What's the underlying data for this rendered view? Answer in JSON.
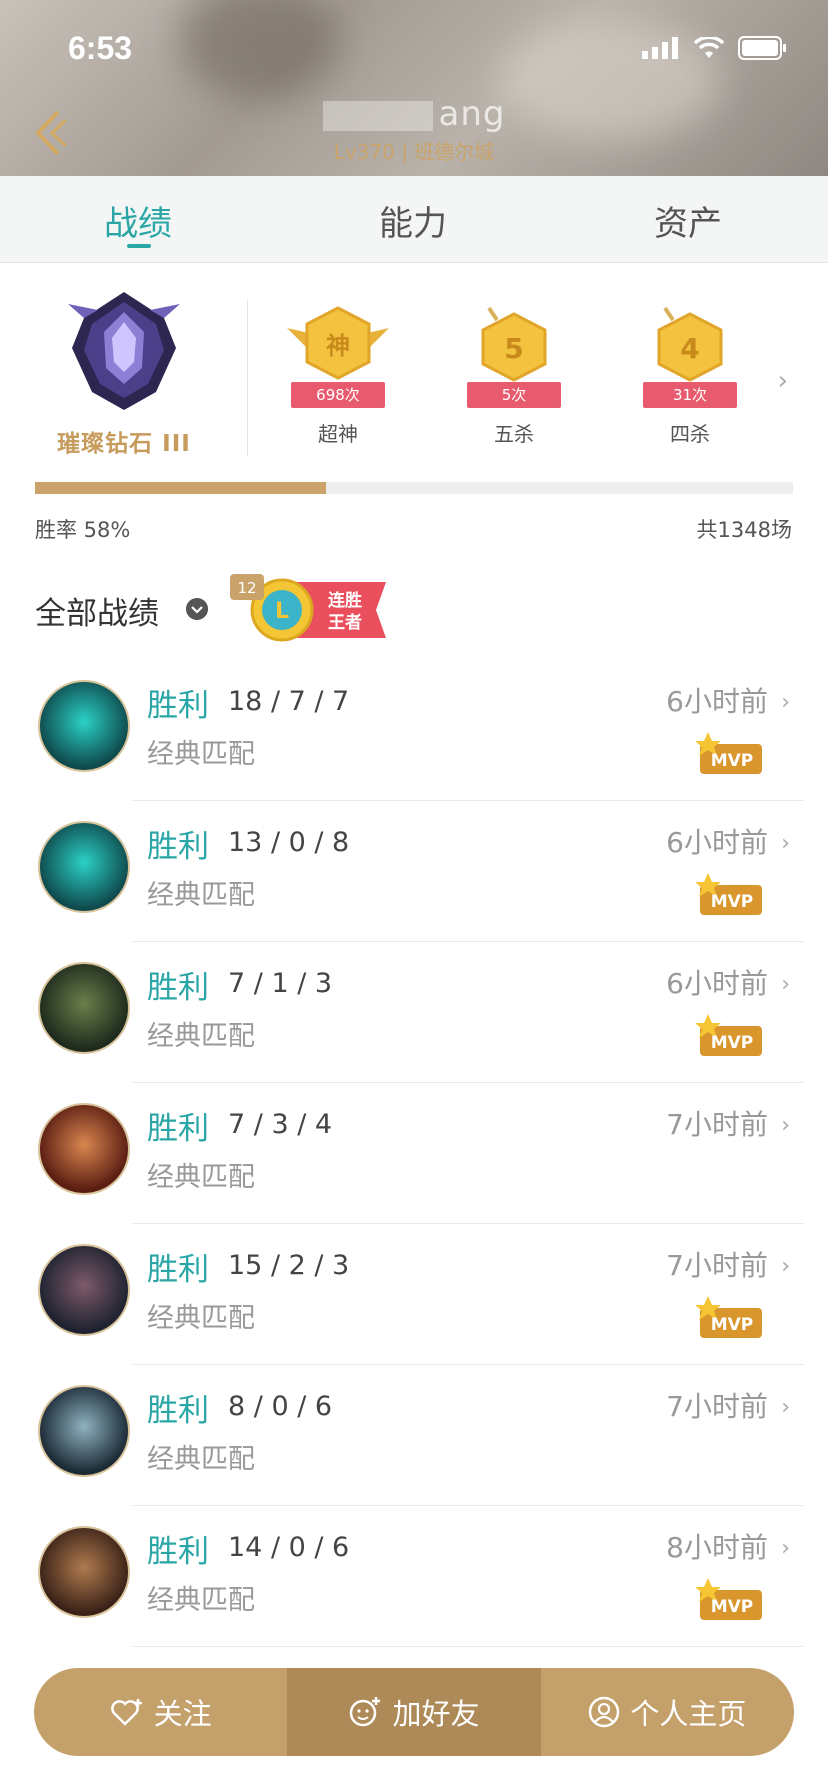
{
  "status_bar": {
    "time": "6:53"
  },
  "header": {
    "username": "ang",
    "subtitle": "Lv370 | 班德尔城"
  },
  "tabs": [
    {
      "label": "战绩",
      "active": true
    },
    {
      "label": "能力",
      "active": false
    },
    {
      "label": "资产",
      "active": false
    }
  ],
  "rank": {
    "label": "璀璨钻石 III"
  },
  "badges": [
    {
      "glyph": "神",
      "count": "698次",
      "label": "超神"
    },
    {
      "glyph": "5",
      "count": "5次",
      "label": "五杀"
    },
    {
      "glyph": "4",
      "count": "31次",
      "label": "四杀"
    }
  ],
  "stats": {
    "win_rate_label": "胜率 58%",
    "win_rate": 0.58,
    "total_label": "共1348场"
  },
  "section": {
    "title": "全部战绩",
    "streak_count": "12",
    "streak_glyph": "L",
    "streak_line1": "连胜",
    "streak_line2": "王者"
  },
  "matches": [
    {
      "result": "胜利",
      "kda": "18 / 7 / 7",
      "mode": "经典匹配",
      "ago": "6小时前",
      "mvp": true
    },
    {
      "result": "胜利",
      "kda": "13 / 0 / 8",
      "mode": "经典匹配",
      "ago": "6小时前",
      "mvp": true
    },
    {
      "result": "胜利",
      "kda": "7 / 1 / 3",
      "mode": "经典匹配",
      "ago": "6小时前",
      "mvp": true
    },
    {
      "result": "胜利",
      "kda": "7 / 3 / 4",
      "mode": "经典匹配",
      "ago": "7小时前",
      "mvp": false
    },
    {
      "result": "胜利",
      "kda": "15 / 2 / 3",
      "mode": "经典匹配",
      "ago": "7小时前",
      "mvp": true
    },
    {
      "result": "胜利",
      "kda": "8 / 0 / 6",
      "mode": "经典匹配",
      "ago": "7小时前",
      "mvp": false
    },
    {
      "result": "胜利",
      "kda": "14 / 0 / 6",
      "mode": "经典匹配",
      "ago": "8小时前",
      "mvp": true
    }
  ],
  "mvp_label": "MVP",
  "bottom_bar": {
    "follow": "关注",
    "add_friend": "加好友",
    "profile": "个人主页"
  },
  "colors": {
    "accent": "#2aa6a6",
    "gold": "#c9a36a",
    "ribbon": "#e85b6f"
  }
}
